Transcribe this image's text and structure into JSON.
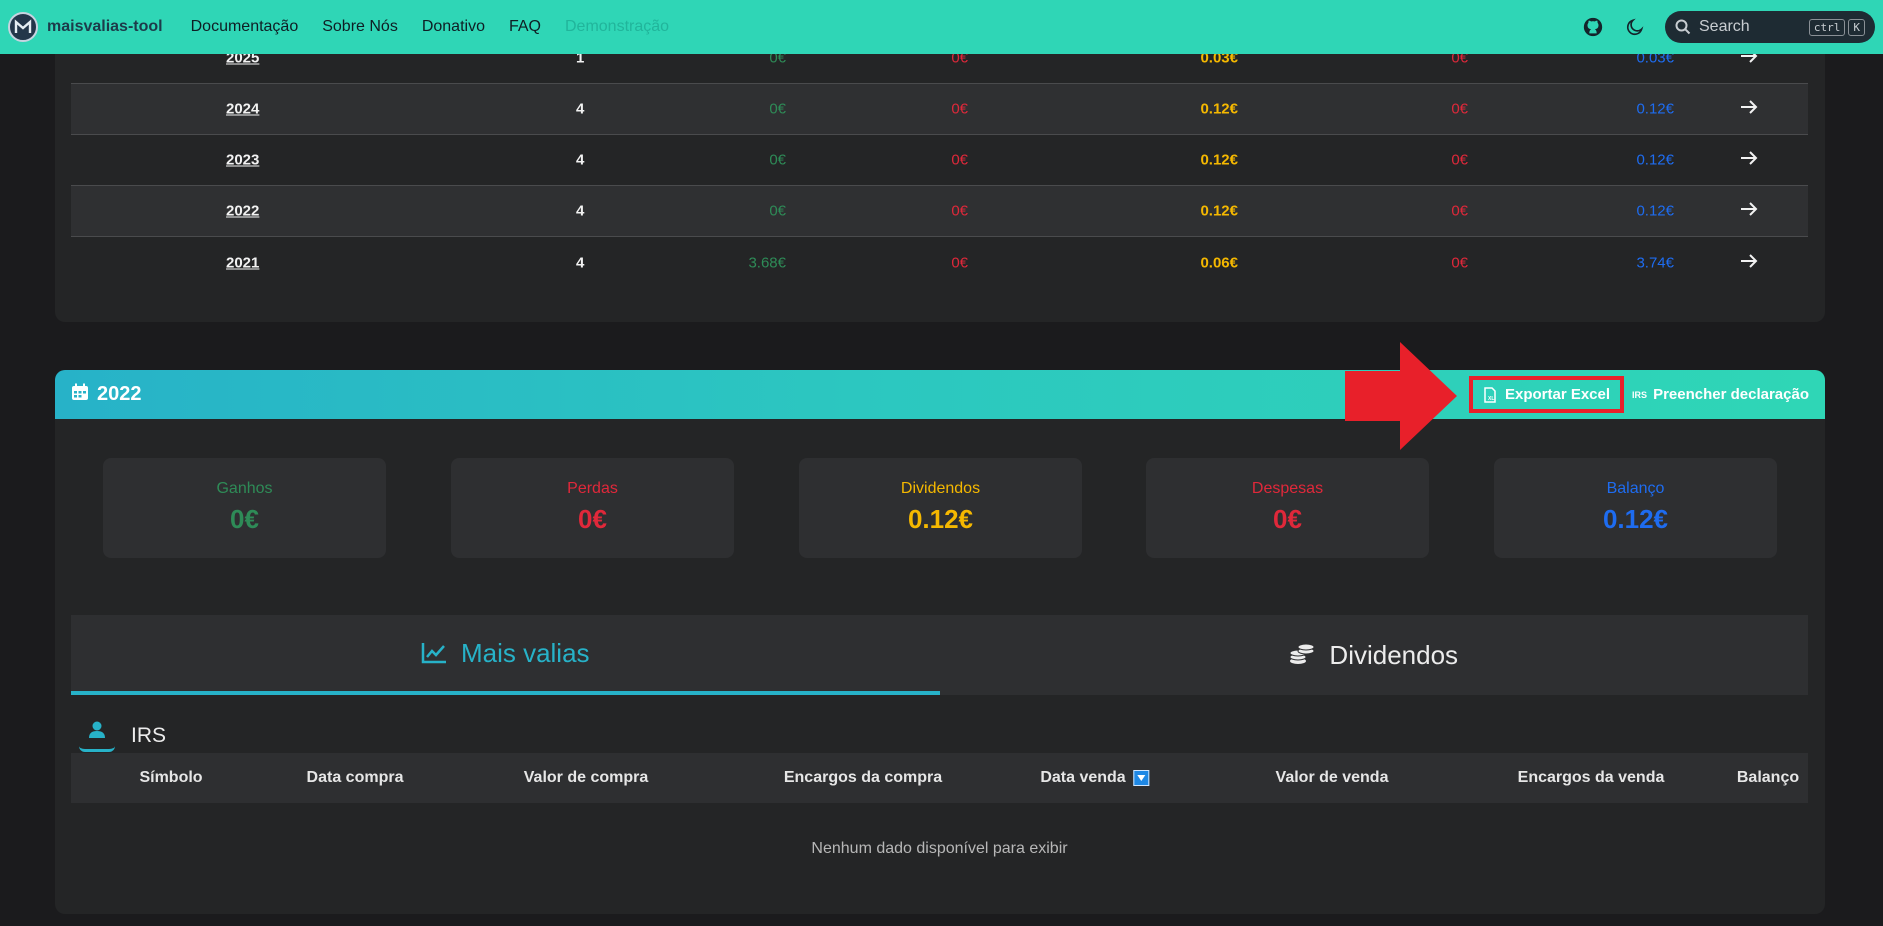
{
  "nav": {
    "brand": "maisvalias-tool",
    "links": [
      "Documentação",
      "Sobre Nós",
      "Donativo",
      "FAQ"
    ],
    "disabled_link": "Demonstração",
    "search_label": "Search",
    "kbd_ctrl": "ctrl",
    "kbd_k": "K"
  },
  "years_table": {
    "rows": [
      {
        "year": "2025",
        "count": "1",
        "gains": "0€",
        "losses": "0€",
        "dividends": "0.03€",
        "expenses": "0€",
        "balance": "0.03€"
      },
      {
        "year": "2024",
        "count": "4",
        "gains": "0€",
        "losses": "0€",
        "dividends": "0.12€",
        "expenses": "0€",
        "balance": "0.12€"
      },
      {
        "year": "2023",
        "count": "4",
        "gains": "0€",
        "losses": "0€",
        "dividends": "0.12€",
        "expenses": "0€",
        "balance": "0.12€"
      },
      {
        "year": "2022",
        "count": "4",
        "gains": "0€",
        "losses": "0€",
        "dividends": "0.12€",
        "expenses": "0€",
        "balance": "0.12€"
      },
      {
        "year": "2021",
        "count": "4",
        "gains": "3.68€",
        "losses": "0€",
        "dividends": "0.06€",
        "expenses": "0€",
        "balance": "3.74€"
      }
    ]
  },
  "detail": {
    "year": "2022",
    "export_label": "Exportar Excel",
    "irs_icon_text": "IRS",
    "fill_label": "Preencher declaração",
    "stats": [
      {
        "label": "Ganhos",
        "value": "0€",
        "color": "#2e8b57"
      },
      {
        "label": "Perdas",
        "value": "0€",
        "color": "#e0283a"
      },
      {
        "label": "Dividendos",
        "value": "0.12€",
        "color": "#f5b800"
      },
      {
        "label": "Despesas",
        "value": "0€",
        "color": "#e0283a"
      },
      {
        "label": "Balanço",
        "value": "0.12€",
        "color": "#1e6cf0"
      }
    ],
    "tabs": {
      "capital_gains": "Mais valias",
      "dividends": "Dividendos"
    },
    "section_label": "IRS",
    "columns": [
      "Símbolo",
      "Data compra",
      "Valor de compra",
      "Encargos da compra",
      "Data venda",
      "Valor de venda",
      "Encargos da venda",
      "Balanço"
    ],
    "empty_message": "Nenhum dado disponível para exibir"
  },
  "colors": {
    "accent": "#2fd6b6",
    "tab_active": "#27b2c8",
    "annotation": "#e8202a"
  }
}
